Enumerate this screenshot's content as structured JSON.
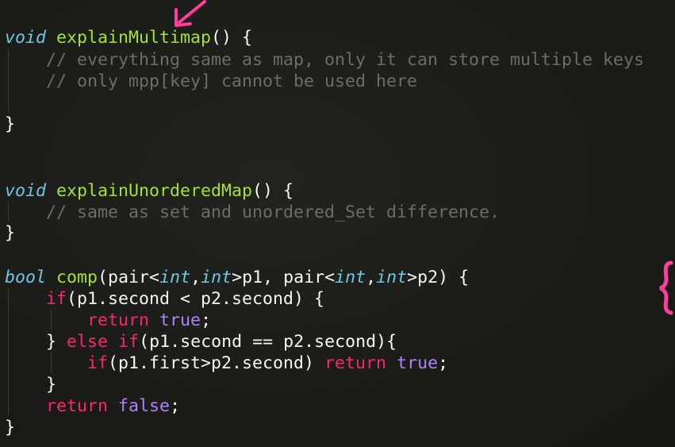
{
  "colors": {
    "background": "#1b1c18",
    "type_keyword": "#6fc7e6",
    "function_name": "#a6e22e",
    "comment": "#6e6d63",
    "control_keyword": "#f92672",
    "constant": "#ae81ff",
    "text": "#f8f8f2",
    "annotation": "#ff3d9a"
  },
  "code": {
    "l1": {
      "type": "void",
      "name": "explainMultimap",
      "rest": "() {"
    },
    "l2": "    // everything same as map, only it can store multiple keys",
    "l3": "    // only mpp[key] cannot be used here",
    "l4": "}",
    "l5": {
      "type": "void",
      "name": "explainUnorderedMap",
      "rest": "() {"
    },
    "l6": "    // same as set and unordered_Set difference.",
    "l7": "}",
    "l8": {
      "type": "bool",
      "name": "comp",
      "p_open": "(pair<",
      "t1": "int",
      "comma1": ",",
      "t2": "int",
      "p1": ">p1, pair<",
      "t3": "int",
      "comma2": ",",
      "t4": "int",
      "p2": ">p2) {"
    },
    "l9": {
      "indent": "    ",
      "kw": "if",
      "rest": "(p1.second < p2.second) {"
    },
    "l10": {
      "indent": "        ",
      "kw": "return",
      "space": " ",
      "val": "true",
      "end": ";"
    },
    "l11": {
      "indent": "    ",
      "brace": "} ",
      "kw_else": "else",
      "space": " ",
      "kw_if": "if",
      "rest": "(p1.second == p2.second){"
    },
    "l12": {
      "indent": "        ",
      "kw_if": "if",
      "cond": "(p1.first>p2.second) ",
      "kw_ret": "return",
      "space": " ",
      "val": "true",
      "end": ";"
    },
    "l13": "    }",
    "l14": {
      "indent": "    ",
      "kw": "return",
      "space": " ",
      "val": "false",
      "end": ";"
    },
    "l15": "}"
  },
  "annotations": {
    "arrow_icon": "pen-arrow-icon",
    "brace_icon": "curly-brace-annotation-icon"
  }
}
